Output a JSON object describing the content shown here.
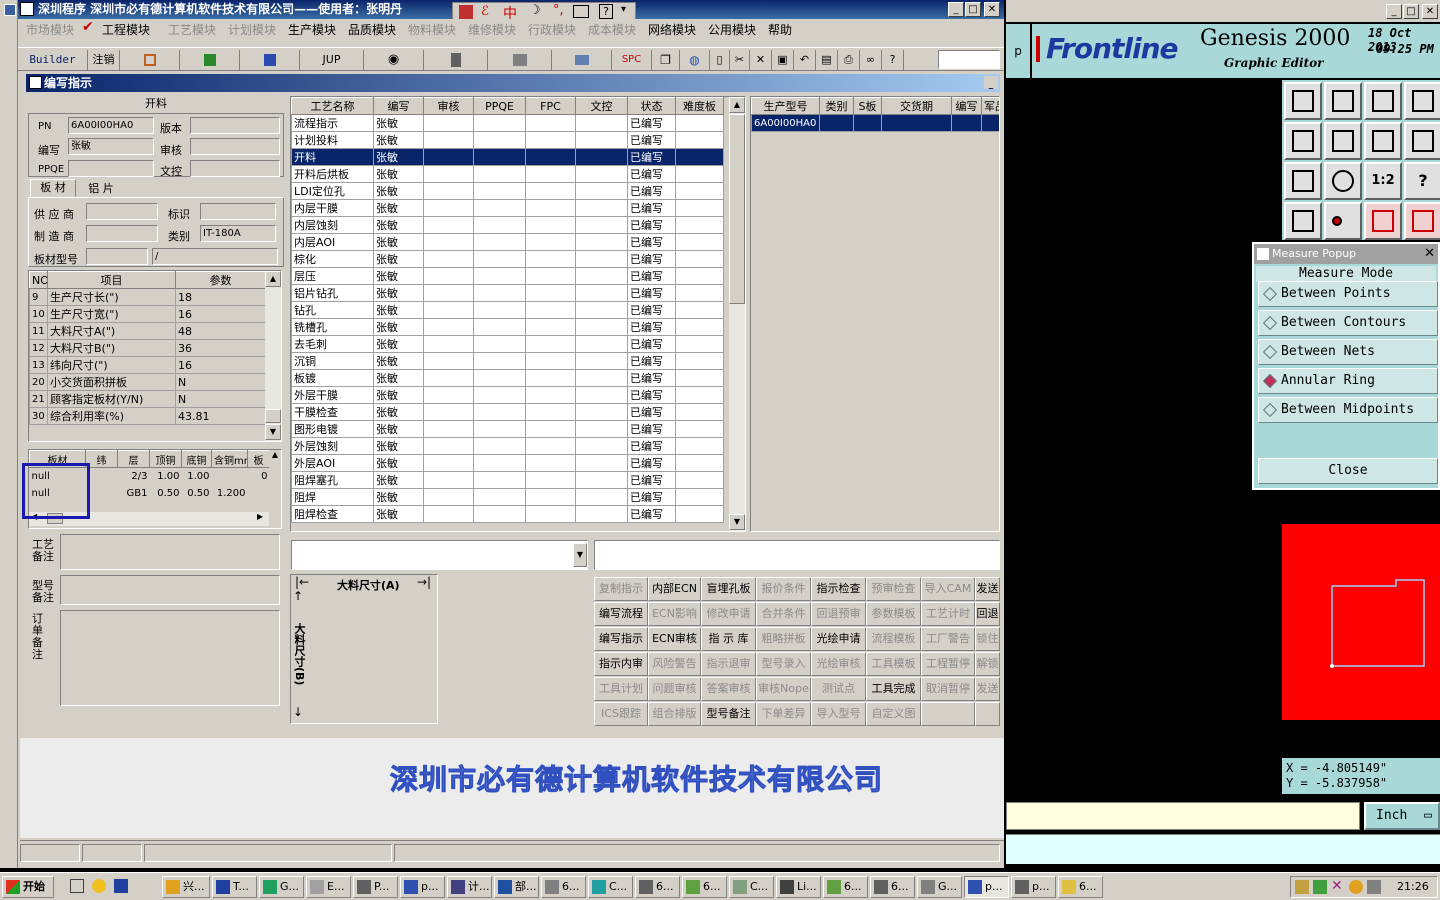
{
  "app": {
    "title": "深圳程序   深圳市必有德计算机软件技术有限公司——使用者：张明丹",
    "tray_icons": [
      "中",
      "☽",
      "°,",
      "?"
    ],
    "menu": [
      {
        "label": "市场模块",
        "enabled": false
      },
      {
        "label": "工程模块",
        "enabled": true,
        "checked": true
      },
      {
        "label": "工艺模块",
        "enabled": false
      },
      {
        "label": "计划模块",
        "enabled": false
      },
      {
        "label": "生产模块",
        "enabled": true
      },
      {
        "label": "品质模块",
        "enabled": true
      },
      {
        "label": "物料模块",
        "enabled": false
      },
      {
        "label": "维修模块",
        "enabled": false
      },
      {
        "label": "行政模块",
        "enabled": false
      },
      {
        "label": "成本模块",
        "enabled": false
      },
      {
        "label": "网络模块",
        "enabled": true
      },
      {
        "label": "公用模块",
        "enabled": true
      },
      {
        "label": "帮助",
        "enabled": true
      }
    ],
    "toolbar": [
      "Builder",
      "注销",
      "JUP",
      "SPC"
    ],
    "subwindow_title": "编写指示"
  },
  "form": {
    "group_label": "开料",
    "pn_label": "PN",
    "pn_value": "6A00I00HA0",
    "version_label": "版本",
    "version_value": "",
    "writer_label": "编写",
    "writer_value": "张敏",
    "review_label": "审核",
    "review_value": "",
    "ppqe_label": "PPQE",
    "ppqe_value": "",
    "doc_label": "文控",
    "doc_value": "",
    "tabs": [
      "板 材",
      "铝 片"
    ],
    "supplier_label": "供 应 商",
    "supplier_value": "",
    "mark_label": "标识",
    "mark_value": "",
    "maker_label": "制 造 商",
    "maker_value": "",
    "type_label": "类别",
    "type_value": "IT-180A",
    "model_label": "板材型号",
    "model_value": "",
    "model_value2": "/"
  },
  "params_table": {
    "headers": [
      "NO",
      "项目",
      "参数"
    ],
    "rows": [
      [
        "9",
        "生产尺寸长(\")",
        "18"
      ],
      [
        "10",
        "生产尺寸宽(\")",
        "16"
      ],
      [
        "11",
        "大料尺寸A(\")",
        "48"
      ],
      [
        "12",
        "大料尺寸B(\")",
        "36"
      ],
      [
        "13",
        "纬向尺寸(\")",
        "16"
      ],
      [
        "20",
        "小交货面积拼板",
        "N"
      ],
      [
        "21",
        "顾客指定板材(Y/N)",
        "N"
      ],
      [
        "30",
        "综合利用率(%)",
        "43.81"
      ]
    ]
  },
  "material_table": {
    "headers": [
      "板材",
      "纬",
      "层",
      "顶铜",
      "底铜",
      "含铜mm",
      "板"
    ],
    "rows": [
      [
        "null",
        "",
        "2/3",
        "1.00",
        "1.00",
        "",
        "0"
      ],
      [
        "null",
        "",
        "GB1",
        "0.50",
        "0.50",
        "1.200",
        ""
      ]
    ]
  },
  "remarks": {
    "process_label": "工艺\n备注",
    "model_label": "型号\n备注",
    "order_label": "订\n单\n备\n注"
  },
  "process_table": {
    "headers": [
      "工艺名称",
      "编写",
      "审核",
      "PPQE",
      "FPC",
      "文控",
      "状态",
      "难度板"
    ],
    "selected_index": 2,
    "rows": [
      [
        "流程指示",
        "张敏",
        "已编写"
      ],
      [
        "计划投料",
        "张敏",
        "已编写"
      ],
      [
        "开料",
        "张敏",
        "已编写"
      ],
      [
        "开料后烘板",
        "张敏",
        "已编写"
      ],
      [
        "LDI定位孔",
        "张敏",
        "已编写"
      ],
      [
        "内层干膜",
        "张敏",
        "已编写"
      ],
      [
        "内层蚀刻",
        "张敏",
        "已编写"
      ],
      [
        "内层AOI",
        "张敏",
        "已编写"
      ],
      [
        "棕化",
        "张敏",
        "已编写"
      ],
      [
        "层压",
        "张敏",
        "已编写"
      ],
      [
        "铝片钻孔",
        "张敏",
        "已编写"
      ],
      [
        "钻孔",
        "张敏",
        "已编写"
      ],
      [
        "铣槽孔",
        "张敏",
        "已编写"
      ],
      [
        "去毛刺",
        "张敏",
        "已编写"
      ],
      [
        "沉铜",
        "张敏",
        "已编写"
      ],
      [
        "板镀",
        "张敏",
        "已编写"
      ],
      [
        "外层干膜",
        "张敏",
        "已编写"
      ],
      [
        "干膜检查",
        "张敏",
        "已编写"
      ],
      [
        "图形电镀",
        "张敏",
        "已编写"
      ],
      [
        "外层蚀刻",
        "张敏",
        "已编写"
      ],
      [
        "外层AOI",
        "张敏",
        "已编写"
      ],
      [
        "阻焊塞孔",
        "张敏",
        "已编写"
      ],
      [
        "阻焊",
        "张敏",
        "已编写"
      ],
      [
        "阻焊检查",
        "张敏",
        "已编写"
      ]
    ]
  },
  "model_table": {
    "headers": [
      "生产型号",
      "类别",
      "S板",
      "交货期",
      "编写",
      "军品"
    ],
    "rows": [
      [
        "6A00I00HA0",
        "",
        "",
        "",
        "",
        ""
      ]
    ]
  },
  "diagram": {
    "a_label": "大料尺寸(A)",
    "b_label": "大料尺寸(B)"
  },
  "function_buttons": [
    [
      {
        "l": "复制指示",
        "e": false
      },
      {
        "l": "内部ECN",
        "e": true
      },
      {
        "l": "盲埋孔板",
        "e": true
      },
      {
        "l": "报价条件",
        "e": false
      },
      {
        "l": "指示检查",
        "e": true
      },
      {
        "l": "预审检查",
        "e": false
      },
      {
        "l": "导入CAM",
        "e": false
      },
      {
        "l": "发送",
        "e": true
      }
    ],
    [
      {
        "l": "编写流程",
        "e": true
      },
      {
        "l": "ECN影响",
        "e": false
      },
      {
        "l": "修改申请",
        "e": false
      },
      {
        "l": "合并条件",
        "e": false
      },
      {
        "l": "回退预审",
        "e": false
      },
      {
        "l": "参数模板",
        "e": false
      },
      {
        "l": "工艺计时",
        "e": false
      },
      {
        "l": "回退",
        "e": true
      }
    ],
    [
      {
        "l": "编写指示",
        "e": true
      },
      {
        "l": "ECN审核",
        "e": true
      },
      {
        "l": "指 示 库",
        "e": true
      },
      {
        "l": "粗略拼板",
        "e": false
      },
      {
        "l": "光绘申请",
        "e": true
      },
      {
        "l": "流程模板",
        "e": false
      },
      {
        "l": "工厂警告",
        "e": false
      },
      {
        "l": "锁住",
        "e": false
      }
    ],
    [
      {
        "l": "指示内审",
        "e": true
      },
      {
        "l": "风险警告",
        "e": false
      },
      {
        "l": "指示退审",
        "e": false
      },
      {
        "l": "型号录入",
        "e": false
      },
      {
        "l": "光绘审核",
        "e": false
      },
      {
        "l": "工具模板",
        "e": false
      },
      {
        "l": "工程暂停",
        "e": false
      },
      {
        "l": "解锁",
        "e": false
      }
    ],
    [
      {
        "l": "工具计划",
        "e": false
      },
      {
        "l": "问题审核",
        "e": false
      },
      {
        "l": "答案审核",
        "e": false
      },
      {
        "l": "审核Nope",
        "e": false
      },
      {
        "l": "测试点",
        "e": false
      },
      {
        "l": "工具完成",
        "e": true
      },
      {
        "l": "取消暂停",
        "e": false
      },
      {
        "l": "发送",
        "e": false
      }
    ],
    [
      {
        "l": "ICS跟踪",
        "e": false
      },
      {
        "l": "组合排版",
        "e": false
      },
      {
        "l": "型号备注",
        "e": true
      },
      {
        "l": "下单差异",
        "e": false
      },
      {
        "l": "导入型号",
        "e": false
      },
      {
        "l": "自定义图",
        "e": false
      },
      {
        "l": "",
        "e": false
      },
      {
        "l": "",
        "e": false
      }
    ]
  ],
  "watermark": "深圳市必有德计算机软件技术有限公司",
  "genesis": {
    "brand": "Frontline",
    "product": "Genesis 2000",
    "subtitle": "Graphic Editor",
    "date": "18 Oct 2013",
    "time": "09:25 PM",
    "tab_letter": "p",
    "measure_popup": {
      "title": "Measure Popup",
      "header": "Measure Mode",
      "options": [
        "Between Points",
        "Between Contours",
        "Between Nets",
        "Annular Ring",
        "Between Midpoints"
      ],
      "selected": "Annular Ring",
      "close_label": "Close"
    },
    "coord_x": "X  =  -4.805149\"",
    "coord_y": "Y  =  -5.837958\"",
    "unit": "Inch",
    "colors": {
      "canvas_fill": "#ff0000",
      "teal": "#a8d8d8"
    }
  },
  "taskbar": {
    "start_label": "开始",
    "tasks": [
      "兴...",
      "T...",
      "G...",
      "E...",
      "P...",
      "p...",
      "计...",
      "部...",
      "6...",
      "C...",
      "6...",
      "6...",
      "C...",
      "Li...",
      "6...",
      "6...",
      "G...",
      "p...",
      "p...",
      "6..."
    ],
    "clock": "21:26"
  }
}
